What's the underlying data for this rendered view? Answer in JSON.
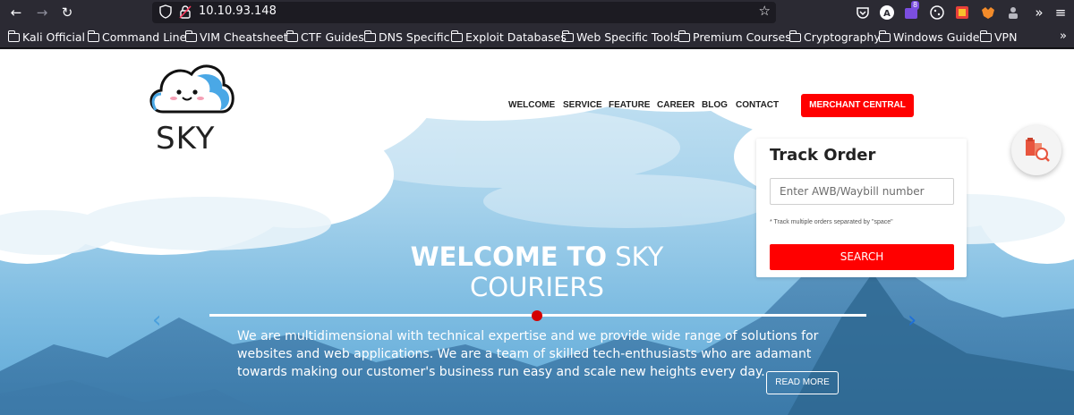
{
  "browser": {
    "url": "10.10.93.148",
    "extension_badge": "8",
    "bookmarks": [
      "Kali Official",
      "Command Line",
      "VIM Cheatsheet",
      "CTF Guides",
      "DNS Specific",
      "Exploit Databases",
      "Web Specific Tools",
      "Premium Courses",
      "Cryptography",
      "Windows Guide",
      "VPN"
    ]
  },
  "site": {
    "logo_text": "SKY",
    "nav": [
      "WELCOME",
      "SERVICE",
      "FEATURE",
      "CAREER",
      "BLOG",
      "CONTACT"
    ],
    "merchant_button": "MERCHANT CENTRAL",
    "track": {
      "title": "Track Order",
      "placeholder": "Enter AWB/Waybill number",
      "hint": "* Track multiple orders separated by \"space\"",
      "button": "SEARCH"
    },
    "hero": {
      "title_bold": "WELCOME TO",
      "title_light_1": "SKY",
      "title_light_2": "COURIERS",
      "description": "We are multidimensional with technical expertise and we provide wide range of solutions for websites and web applications. We are a team of skilled tech-enthusiasts who are adamant towards making our customer's business run easy and scale new heights every day.",
      "read_more": "READ MORE",
      "prev_arrow": "‹",
      "next_arrow": "›"
    }
  },
  "colors": {
    "accent": "#ff0000",
    "chrome": "#2b2a33"
  }
}
